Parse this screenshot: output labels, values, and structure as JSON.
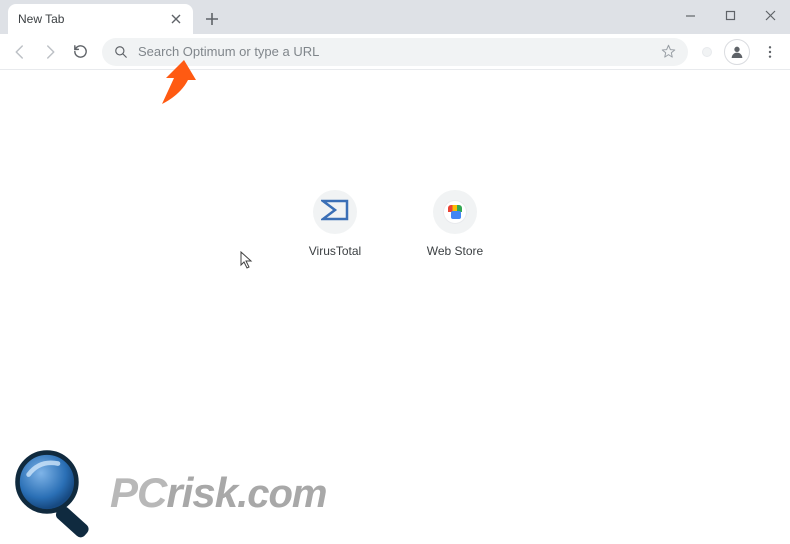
{
  "tab": {
    "title": "New Tab"
  },
  "omnibox": {
    "placeholder": "Search Optimum or type a URL"
  },
  "shortcuts": [
    {
      "label": "VirusTotal",
      "icon": "virustotal"
    },
    {
      "label": "Web Store",
      "icon": "webstore"
    }
  ],
  "watermark": {
    "pc": "PC",
    "risk": "risk",
    "suffix": ".com"
  }
}
